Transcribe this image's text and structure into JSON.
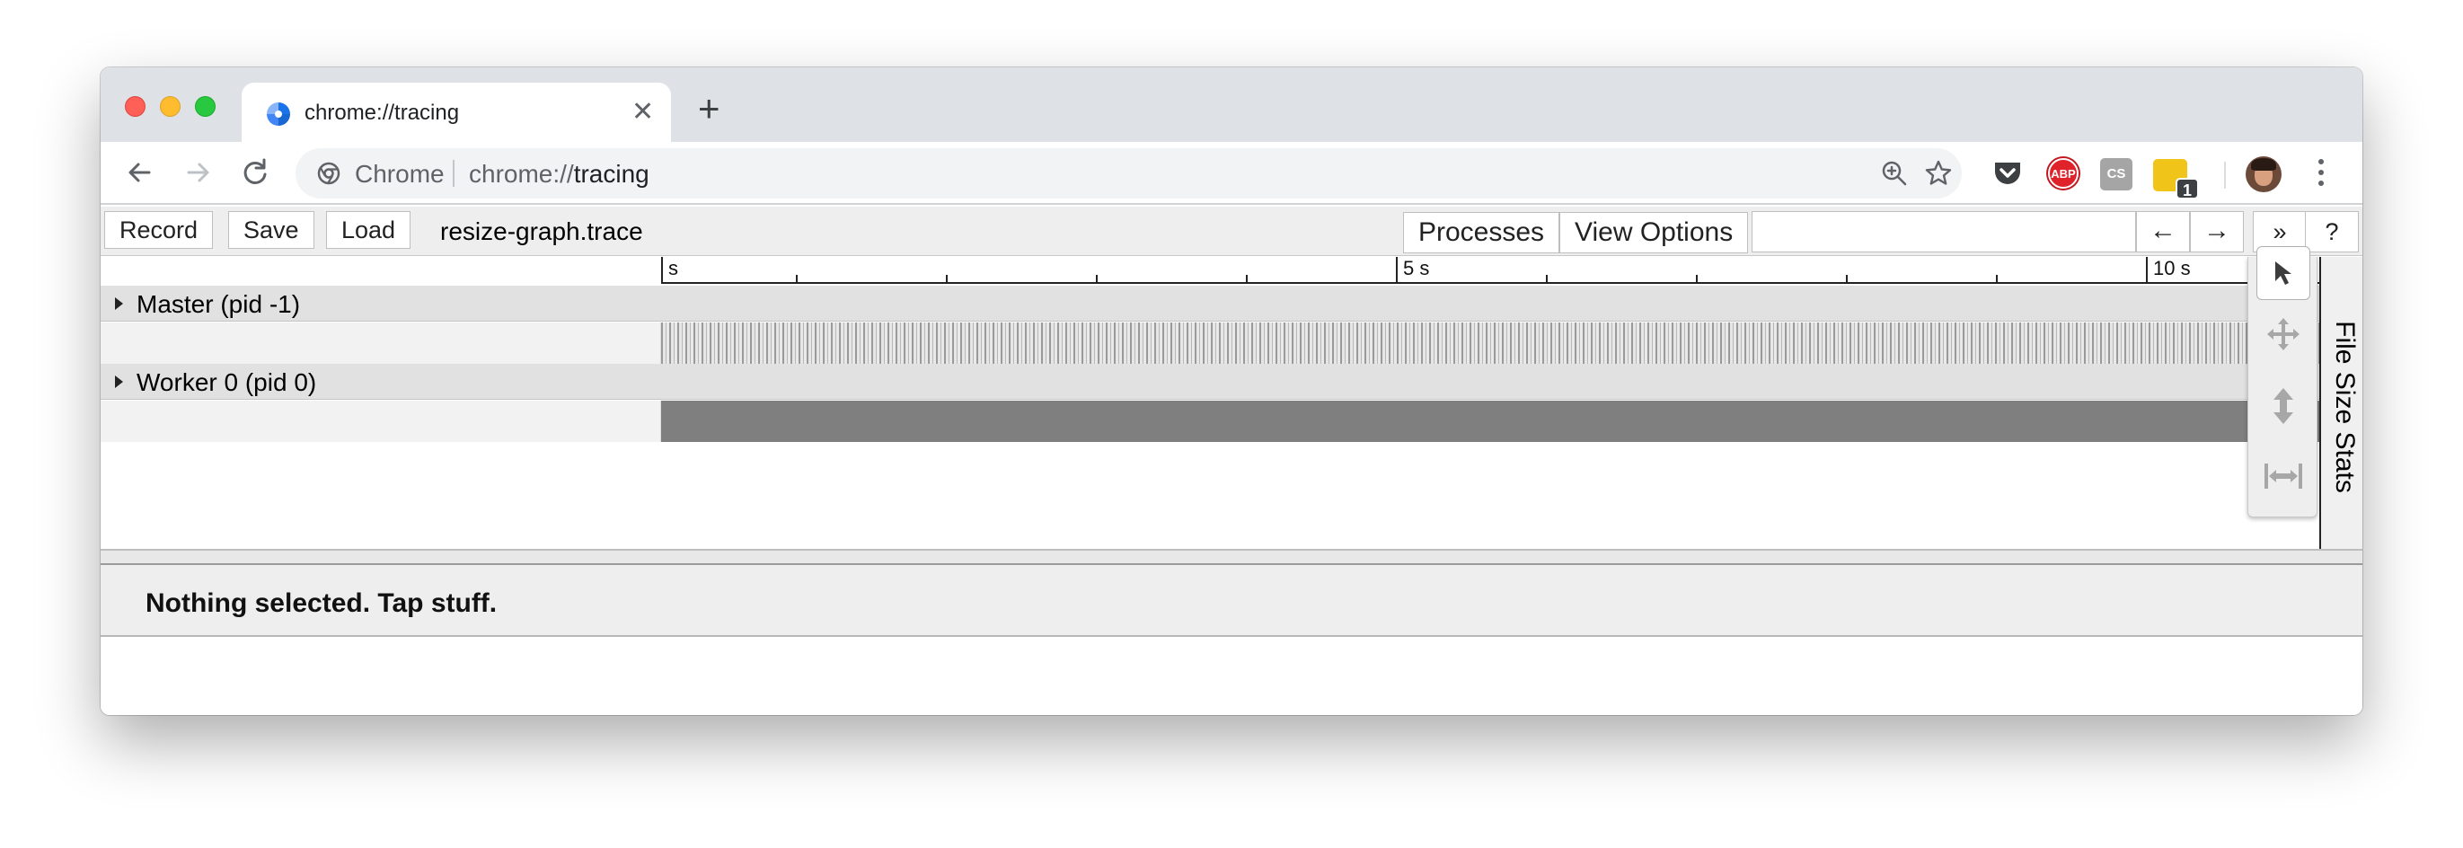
{
  "browser": {
    "tab": {
      "title": "chrome://tracing",
      "favicon": "chrome-tracing-favicon",
      "close_label": "✕"
    },
    "new_tab_label": "+",
    "omnibox": {
      "chip": "Chrome",
      "url_scheme": "chrome://",
      "url_host": "tracing"
    },
    "extensions": {
      "abp_label": "ABP",
      "cs_label": "CS",
      "badge": "1"
    },
    "colors": {
      "tabstrip": "#dee1e6",
      "abp": "#e0232b",
      "yellow_ext": "#f0c419"
    }
  },
  "tracing": {
    "toolbar": {
      "record": "Record",
      "save": "Save",
      "load": "Load",
      "filename": "resize-graph.trace",
      "processes": "Processes",
      "view_options": "View Options",
      "search_value": "",
      "prev": "←",
      "next": "→",
      "more": "»",
      "help": "?"
    },
    "ruler": {
      "labels": [
        "s",
        "5 s",
        "10 s"
      ]
    },
    "processes": [
      {
        "label": "Master (pid -1)",
        "track": "dense"
      },
      {
        "label": "Worker 0 (pid 0)",
        "track": "solid"
      }
    ],
    "side_tab": "File Size Stats",
    "mouse_modes": [
      "selection-mode-icon",
      "pan-mode-icon",
      "zoom-mode-icon",
      "timing-mode-icon"
    ],
    "analysis": {
      "status": "Nothing selected. Tap stuff."
    }
  }
}
